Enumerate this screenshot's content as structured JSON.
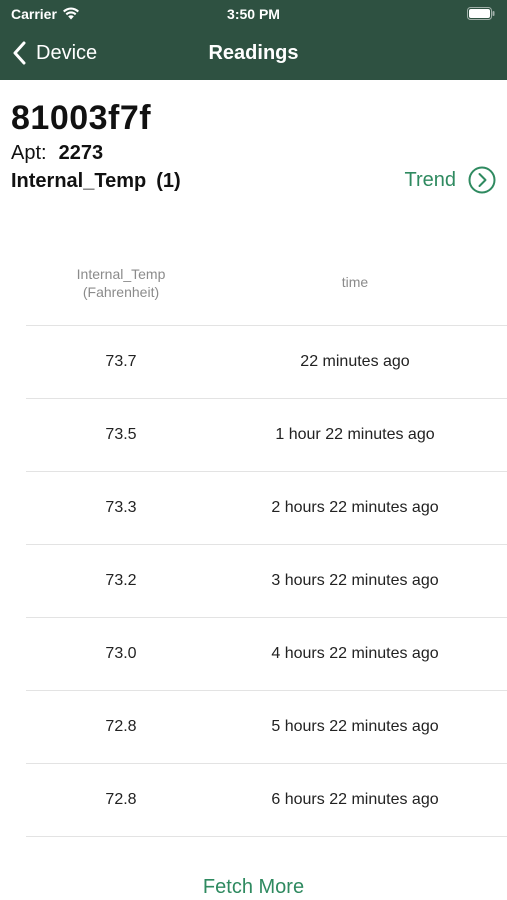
{
  "status_bar": {
    "carrier": "Carrier",
    "time": "3:50 PM"
  },
  "nav": {
    "back_label": "Device",
    "title": "Readings"
  },
  "device": {
    "id": "81003f7f",
    "apt_label": "Apt:",
    "apt_value": "2273",
    "sensor_name": "Internal_Temp",
    "sensor_count": "(1)",
    "trend_label": "Trend"
  },
  "table": {
    "headers": {
      "value_line1": "Internal_Temp",
      "value_line2": "(Fahrenheit)",
      "time": "time"
    },
    "rows": [
      {
        "value": "73.7",
        "time": "22 minutes ago"
      },
      {
        "value": "73.5",
        "time": "1 hour 22 minutes ago"
      },
      {
        "value": "73.3",
        "time": "2 hours 22 minutes ago"
      },
      {
        "value": "73.2",
        "time": "3 hours 22 minutes ago"
      },
      {
        "value": "73.0",
        "time": "4 hours 22 minutes ago"
      },
      {
        "value": "72.8",
        "time": "5 hours 22 minutes ago"
      },
      {
        "value": "72.8",
        "time": "6 hours 22 minutes ago"
      }
    ]
  },
  "fetch_more_label": "Fetch More",
  "colors": {
    "nav_bg": "#2e5141",
    "accent": "#2f8a60"
  },
  "icons": {
    "back": "chevron-left-icon",
    "trend": "chevron-right-circle-icon",
    "wifi": "wifi-icon",
    "battery": "battery-icon"
  }
}
